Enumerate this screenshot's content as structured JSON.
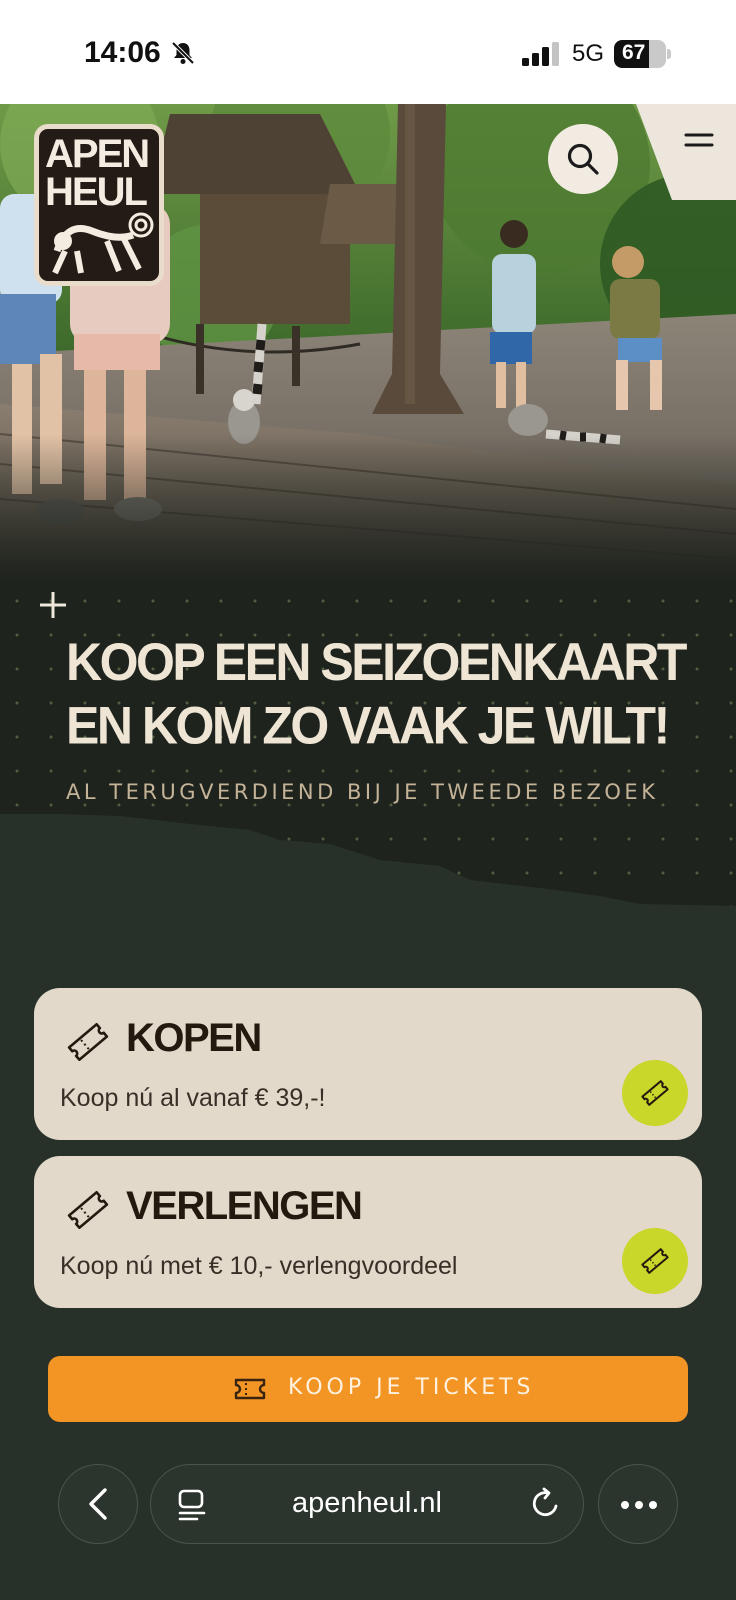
{
  "status_bar": {
    "time": "14:06",
    "network": "5G",
    "battery": "67",
    "battery_level": 0.67
  },
  "header": {
    "logo_text": "APEN HEUL"
  },
  "promo": {
    "title": "KOOP EEN SEIZOENKAART EN KOM ZO VAAK JE WILT!",
    "subtitle": "AL TERUGVERDIEND BIJ JE TWEEDE BEZOEK"
  },
  "cards": [
    {
      "title": "KOPEN",
      "description": "Koop nú al vanaf € 39,-!"
    },
    {
      "title": "VERLENGEN",
      "description": "Koop nú met € 10,- verlengvoordeel"
    }
  ],
  "cta": {
    "label": "KOOP JE TICKETS"
  },
  "browser": {
    "url": "apenheul.nl"
  },
  "colors": {
    "page_bg": "#283129",
    "card_bg": "#e2d9cb",
    "accent_lime": "#c9d62a",
    "cta_orange": "#f29524",
    "title_cream": "#efe5d4"
  },
  "icons": [
    "bell-slash-icon",
    "signal-icon",
    "search-icon",
    "menu-icon",
    "plus-icon",
    "ticket-icon",
    "back-icon",
    "tabs-icon",
    "reload-icon",
    "more-icon"
  ]
}
